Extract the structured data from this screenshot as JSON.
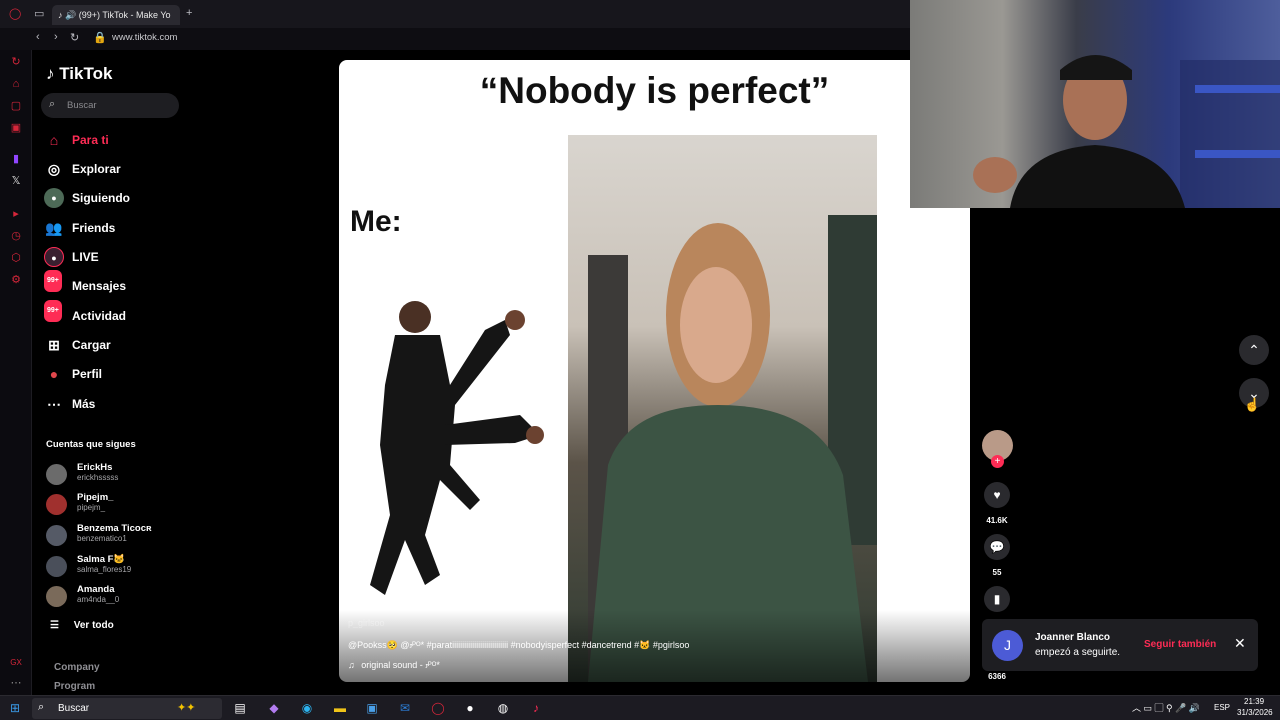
{
  "browser": {
    "tab_title": "(99+) TikTok - Make Yo",
    "new_tab_symbol": "+",
    "url": "www.tiktok.com"
  },
  "tiktok": {
    "logo_text": "TikTok",
    "search_placeholder": "Buscar",
    "nav": [
      {
        "label": "Para ti",
        "icon": "home-icon",
        "active": true
      },
      {
        "label": "Explorar",
        "icon": "compass-icon"
      },
      {
        "label": "Siguiendo",
        "icon": "following-avatar-icon"
      },
      {
        "label": "Friends",
        "icon": "friends-icon"
      },
      {
        "label": "LIVE",
        "icon": "live-icon"
      },
      {
        "label": "Mensajes",
        "icon": "messages-icon",
        "badge": "99+"
      },
      {
        "label": "Actividad",
        "icon": "activity-icon",
        "badge": "99+"
      },
      {
        "label": "Cargar",
        "icon": "upload-icon"
      },
      {
        "label": "Perfil",
        "icon": "profile-icon"
      },
      {
        "label": "Más",
        "icon": "more-icon"
      }
    ],
    "following_heading": "Cuentas que sigues",
    "following": [
      {
        "name": "ErickHs",
        "handle": "erickhsssss"
      },
      {
        "name": "Pipejm_",
        "handle": "pipejm_"
      },
      {
        "name": "Benzema Ticoᴄʀ",
        "handle": "benzematico1"
      },
      {
        "name": "Salma F🐱",
        "handle": "salma_flores19"
      },
      {
        "name": "Amanda",
        "handle": "am4nda__0"
      }
    ],
    "see_all": "Ver todo",
    "footer_links": [
      "Company",
      "Program"
    ]
  },
  "video": {
    "title": "“Nobody is perfect”",
    "me_label": "Me:",
    "creator_faint": "p_girlsoo",
    "caption": "@Pookss🥺 @ꭻᴾᴼ* #paratiiiiiiiiiiiiiiiiiiiiiiiiiiii #nobodyisperfect #dancetrend #🐱 #pgirlsoo",
    "sound": "original sound - ꭻᴾᴼ*",
    "likes": "41.6K",
    "comments": "55",
    "saves": "6366"
  },
  "notification": {
    "avatar_letter": "J",
    "name": "Joanner Blanco",
    "message": "empezó a seguirte.",
    "action": "Seguir también"
  },
  "taskbar": {
    "search_label": "Buscar",
    "language": "ESP",
    "time": "21:39",
    "date": "31/3/2026"
  },
  "colors": {
    "brand": "#fe2c55",
    "background": "#000000",
    "search_bg": "#1e1e22"
  }
}
